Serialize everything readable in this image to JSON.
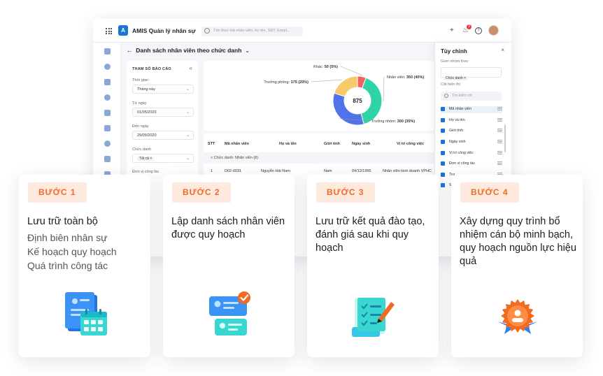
{
  "app": {
    "title": "AMIS Quản lý nhân sự",
    "logo_letter": "A",
    "search_placeholder": "Tìm theo mã nhân viên, họ tên, SĐT, Email...",
    "notification_count": "3",
    "page_title": "Danh sách nhân viên theo chức danh"
  },
  "params": {
    "title": "THAM SỐ BÁO CÁO",
    "fields": [
      {
        "label": "Thời gian",
        "value": "Tháng này"
      },
      {
        "label": "Từ ngày",
        "value": "01/05/2020"
      },
      {
        "label": "Đến ngày",
        "value": "29/05/2020"
      },
      {
        "label": "Chức danh",
        "value": "Tất cả"
      }
    ],
    "last_label": "Đơn vị công tác"
  },
  "chart_data": {
    "type": "pie",
    "center_label": "875",
    "slices": [
      {
        "label": "Khác",
        "value": 50,
        "pct": "5%",
        "color": "#f06262"
      },
      {
        "label": "Nhân viên",
        "value": 350,
        "pct": "40%",
        "color": "#2ed3a6"
      },
      {
        "label": "Trưởng nhóm",
        "value": 300,
        "pct": "35%",
        "color": "#4f73e8"
      },
      {
        "label": "Trưởng phòng",
        "value": 175,
        "pct": "20%",
        "color": "#f7c96b"
      }
    ]
  },
  "table": {
    "headers": [
      "STT",
      "Mã nhân viên",
      "Họ và tên",
      "Giới tính",
      "Ngày sinh",
      "Vị trí công việc"
    ],
    "group_label": "Chức danh: Nhân viên (8)",
    "first_row": [
      "1",
      "D02-0031",
      "Nguyễn Hải Nam",
      "Nam",
      "04/12/1995",
      "Nhân viên kinh doanh VPHC"
    ]
  },
  "customize": {
    "title": "Tùy chỉnh",
    "group_label": "Gom nhóm theo",
    "group_chip": "Chức danh",
    "columns_label": "Cột hiển thị",
    "search_placeholder": "Tìm kiếm cột",
    "columns": [
      "Mã nhân viên",
      "Họ và tên",
      "Giới tính",
      "Ngày sinh",
      "Vị trí công việc",
      "Đơn vị công tác",
      "Trư...",
      "Số..."
    ]
  },
  "steps": [
    {
      "badge": "BƯỚC 1",
      "title": "Lưu trữ toàn bộ",
      "subs": [
        "Định biên nhân sự",
        "Kế hoạch quy hoạch",
        "Quá trình công tác"
      ],
      "icon": "documents-calendar-icon"
    },
    {
      "badge": "BƯỚC 2",
      "title": "Lập danh sách nhân viên được quy hoạch",
      "subs": [],
      "icon": "employee-cards-check-icon"
    },
    {
      "badge": "BƯỚC 3",
      "title": "Lưu trữ kết quả đào tạo, đánh giá sau khi quy hoạch",
      "subs": [],
      "icon": "checklist-pen-icon"
    },
    {
      "badge": "BƯỚC 4",
      "title": "Xây dựng quy trình bổ nhiệm cán bộ minh bạch, quy hoạch nguồn lực hiệu quả",
      "subs": [],
      "icon": "award-badge-icon"
    }
  ],
  "colors": {
    "accent": "#f26a21",
    "badge_bg": "#fde9de",
    "brand": "#1a76d2"
  }
}
